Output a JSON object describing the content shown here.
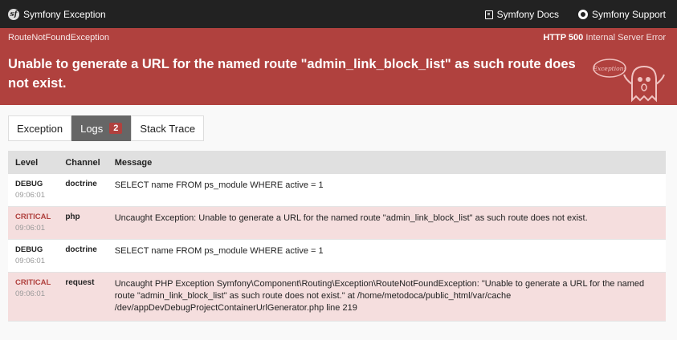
{
  "topbar": {
    "brand": "Symfony Exception",
    "docs_link": "Symfony Docs",
    "support_link": "Symfony Support"
  },
  "header": {
    "exception_class": "RouteNotFoundException",
    "status_code": "HTTP 500",
    "status_text": "Internal Server Error",
    "message": "Unable to generate a URL for the named route \"admin_link_block_list\" as such route does not exist.",
    "ghost_label": "Exception!"
  },
  "tabs": [
    {
      "label": "Exception"
    },
    {
      "label": "Logs",
      "count": "2"
    },
    {
      "label": "Stack Trace"
    }
  ],
  "logs": {
    "headers": {
      "level": "Level",
      "channel": "Channel",
      "message": "Message"
    },
    "rows": [
      {
        "level": "DEBUG",
        "time": "09:06:01",
        "channel": "doctrine",
        "message": "SELECT name FROM ps_module WHERE active = 1"
      },
      {
        "level": "CRITICAL",
        "time": "09:06:01",
        "channel": "php",
        "message": "Uncaught Exception: Unable to generate a URL for the named route \"admin_link_block_list\" as such route does not exist."
      },
      {
        "level": "DEBUG",
        "time": "09:06:01",
        "channel": "doctrine",
        "message": "SELECT name FROM ps_module WHERE active = 1"
      },
      {
        "level": "CRITICAL",
        "time": "09:06:01",
        "channel": "request",
        "message": "Uncaught PHP Exception Symfony\\Component\\Routing\\Exception\\RouteNotFoundException: \"Unable to generate a URL for the named route \"admin_link_block_list\" as such route does not exist.\" at /home/metodoca/public_html/var/cache /dev/appDevDebugProjectContainerUrlGenerator.php line 219"
      }
    ]
  },
  "colors": {
    "header_red": "#b0413e",
    "critical_row": "#f5dede",
    "topbar": "#222222"
  }
}
